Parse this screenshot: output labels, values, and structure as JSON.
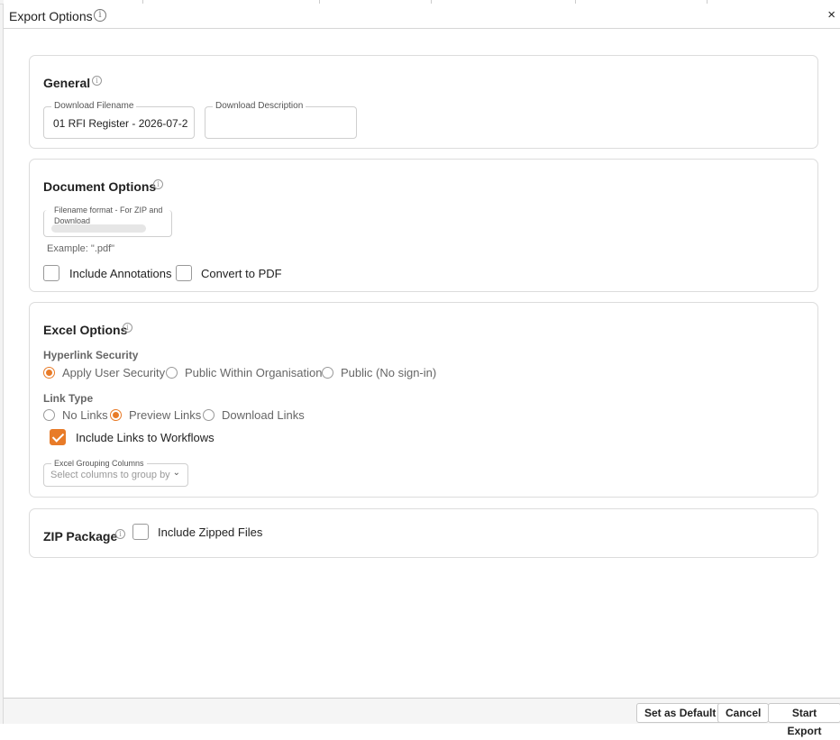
{
  "dialog": {
    "title": "Export Options",
    "close_icon": "×"
  },
  "general": {
    "title": "General",
    "filename_label": "Download Filename",
    "filename_value": "01 RFI Register - 2026-07-2",
    "description_label": "Download Description",
    "description_value": ""
  },
  "document_options": {
    "title": "Document Options",
    "filename_format_label": "Filename format - For ZIP and Download",
    "example_text": "Example: \".pdf\"",
    "include_annotations_label": "Include Annotations",
    "include_annotations_checked": false,
    "convert_pdf_label": "Convert to PDF",
    "convert_pdf_checked": false
  },
  "excel_options": {
    "title": "Excel Options",
    "hyperlink_security_heading": "Hyperlink Security",
    "hyperlink_options": [
      {
        "label": "Apply User Security",
        "checked": true
      },
      {
        "label": "Public Within Organisation",
        "checked": false
      },
      {
        "label": "Public (No sign-in)",
        "checked": false
      }
    ],
    "link_type_heading": "Link Type",
    "link_type_options": [
      {
        "label": "No Links",
        "checked": false
      },
      {
        "label": "Preview Links",
        "checked": true
      },
      {
        "label": "Download Links",
        "checked": false
      }
    ],
    "include_workflows_label": "Include Links to Workflows",
    "include_workflows_checked": true,
    "grouping_label": "Excel Grouping Columns",
    "grouping_placeholder": "Select columns to group by"
  },
  "zip_package": {
    "title": "ZIP Package",
    "include_zipped_label": "Include Zipped Files",
    "include_zipped_checked": false
  },
  "footer": {
    "set_default_label": "Set as Default",
    "cancel_label": "Cancel",
    "start_export_label": "Start Export"
  },
  "colors": {
    "accent": "#e87b28",
    "border": "#dcdcdc"
  }
}
